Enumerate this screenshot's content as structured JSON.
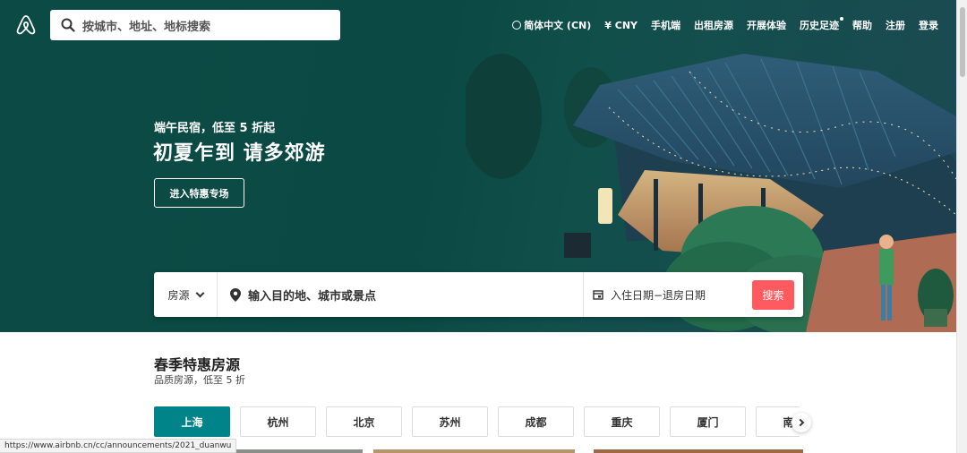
{
  "header": {
    "search_placeholder": "按城市、地址、地标搜索",
    "nav": [
      {
        "label": "简体中文 (CN)",
        "icon": "globe-icon"
      },
      {
        "label": "¥ CNY"
      },
      {
        "label": "手机端"
      },
      {
        "label": "出租房源"
      },
      {
        "label": "开展体验"
      },
      {
        "label": "历史足迹"
      },
      {
        "label": "帮助"
      },
      {
        "label": "注册"
      },
      {
        "label": "登录"
      }
    ]
  },
  "hero": {
    "subtitle": "端午民宿，低至 5 折起",
    "title": "初夏乍到 请多郊游",
    "cta": "进入特惠专场"
  },
  "search": {
    "type_label": "房源",
    "destination_placeholder": "输入目的地、城市或景点",
    "dates_placeholder": "入住日期−退房日期",
    "button": "搜索"
  },
  "section": {
    "title": "春季特惠房源",
    "subtitle": "品质房源，低至 5 折",
    "cities": [
      "上海",
      "杭州",
      "北京",
      "苏州",
      "成都",
      "重庆",
      "厦门",
      "南京"
    ],
    "active_city": "上海"
  },
  "status_url": "https://www.airbnb.cn/cc/announcements/2021_duanwu",
  "colors": {
    "hero_bg": "#0c4a45",
    "accent_teal": "#00848a",
    "search_red": "#ff5a5f"
  }
}
